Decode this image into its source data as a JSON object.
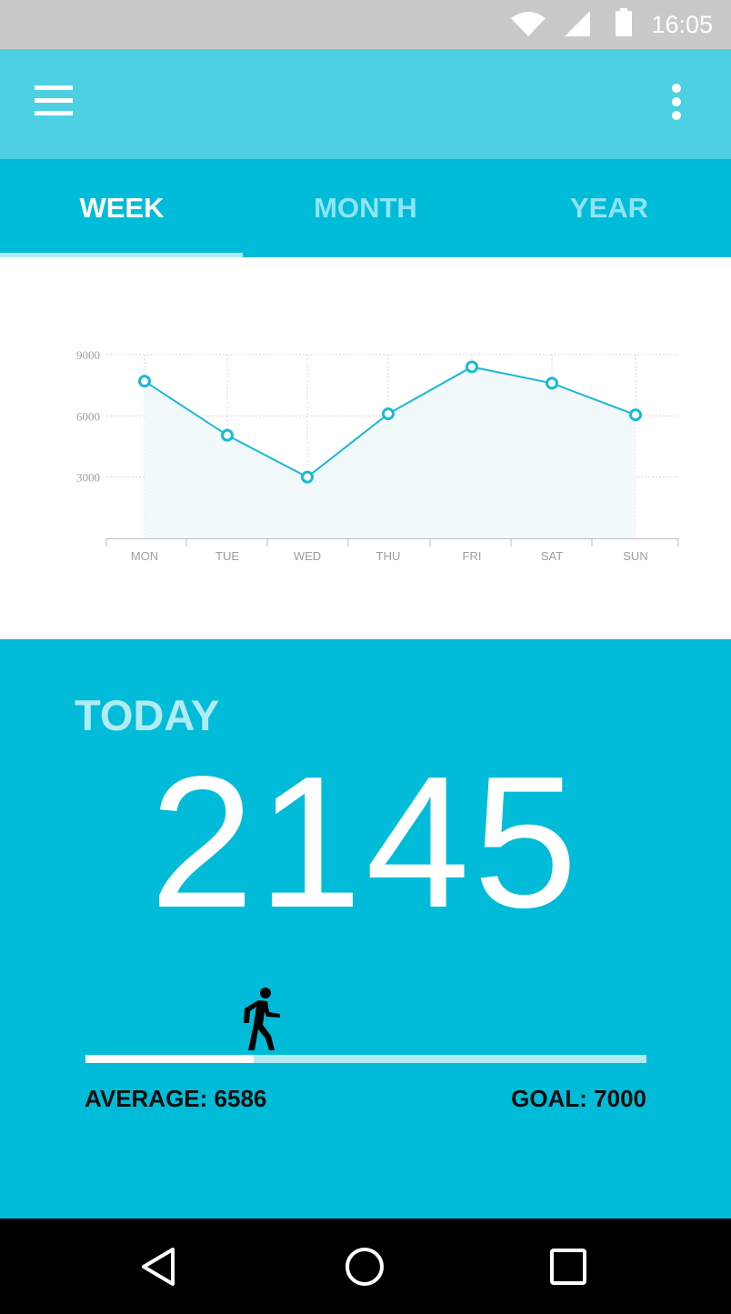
{
  "status_bar": {
    "time": "16:05",
    "icons": [
      "wifi-icon",
      "signal-icon",
      "battery-icon"
    ]
  },
  "app_bar": {
    "icons": [
      "menu-icon",
      "more-vert-icon"
    ]
  },
  "tabs": [
    {
      "label": "WEEK",
      "active": true
    },
    {
      "label": "MONTH",
      "active": false
    },
    {
      "label": "YEAR",
      "active": false
    }
  ],
  "chart_data": {
    "type": "area",
    "categories": [
      "MON",
      "TUE",
      "WED",
      "THU",
      "FRI",
      "SAT",
      "SUN"
    ],
    "values": [
      7700,
      5050,
      3000,
      6100,
      8400,
      7600,
      6050
    ],
    "yticks": [
      3000,
      6000,
      9000
    ],
    "ylim": [
      0,
      9000
    ],
    "grid": true,
    "colors": {
      "line": "#1ab9d4",
      "fill": "#f1f9fb",
      "grid": "#d8d8d8",
      "axis": "#bdbdbd",
      "tick_label": "#9e9e9e"
    }
  },
  "today": {
    "label": "TODAY",
    "steps": "2145",
    "average_label": "AVERAGE: 6586",
    "goal_label": "GOAL: 7000",
    "progress": 0.3,
    "icon": "walking-person-icon"
  },
  "nav_bar": {
    "icons": [
      "back-icon",
      "home-icon",
      "recents-icon"
    ]
  },
  "colors": {
    "status_bar": "#c9c9c9",
    "app_bar": "#4dd0e1",
    "primary": "#00bcd8",
    "accent_light": "#b2ebf2"
  }
}
